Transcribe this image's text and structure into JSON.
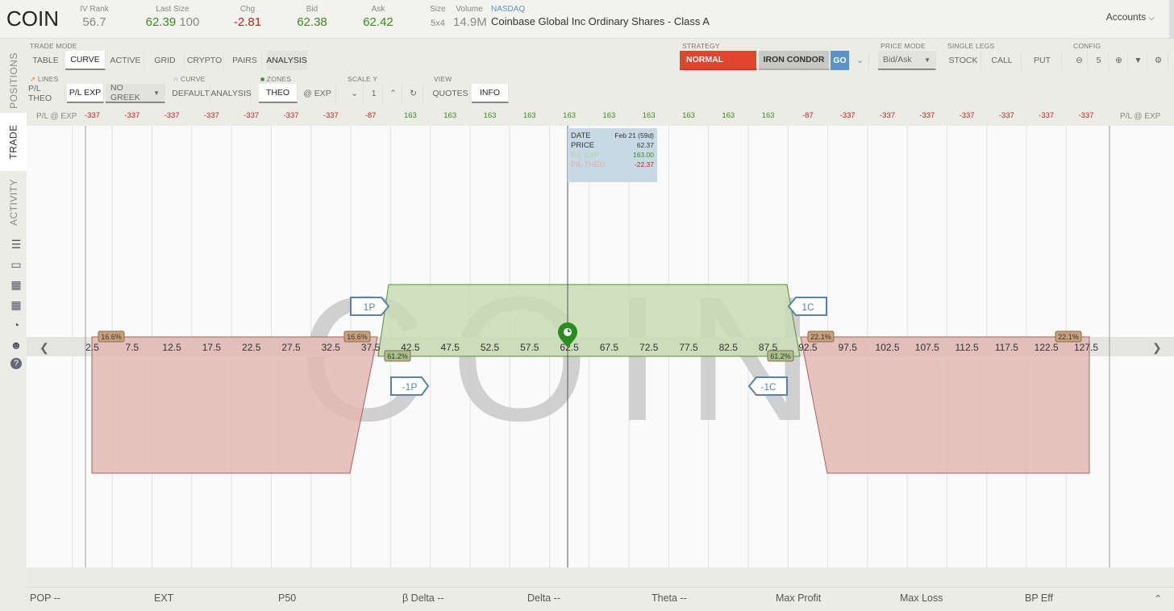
{
  "header": {
    "symbol": "COIN",
    "iv_rank": {
      "label": "IV Rank",
      "value": "56.7"
    },
    "last_size": {
      "label": "Last Size",
      "value": "62.39",
      "size": "100"
    },
    "chg": {
      "label": "Chg",
      "value": "-2.81"
    },
    "bid": {
      "label": "Bid",
      "value": "62.38"
    },
    "ask": {
      "label": "Ask",
      "value": "62.42"
    },
    "size": {
      "label": "Size",
      "value": "5x4"
    },
    "volume": {
      "label": "Volume",
      "value": "14.9M"
    },
    "exchange": "NASDAQ",
    "company": "Coinbase Global Inc Ordinary Shares - Class A",
    "accounts": "Accounts"
  },
  "sidebar": {
    "tabs": [
      "POSITIONS",
      "TRADE",
      "ACTIVITY"
    ]
  },
  "toolbar": {
    "trade_mode": {
      "label": "TRADE MODE",
      "buttons": [
        "TABLE",
        "CURVE",
        "ACTIVE",
        "GRID",
        "CRYPTO",
        "PAIRS",
        "ANALYSIS"
      ]
    },
    "lines": {
      "label": "LINES",
      "buttons": [
        "P/L THEO",
        "P/L EXP"
      ],
      "greek": "NO GREEK"
    },
    "curve": {
      "label": "CURVE",
      "buttons": [
        "DEFAULT",
        "ANALYSIS"
      ]
    },
    "zones": {
      "label": "ZONES",
      "buttons": [
        "THEO",
        "@ EXP"
      ]
    },
    "scale_y": {
      "label": "SCALE Y",
      "value": "1"
    },
    "view": {
      "label": "VIEW",
      "buttons": [
        "QUOTES",
        "INFO"
      ]
    },
    "strategy": {
      "label": "STRATEGY",
      "normal": "NORMAL",
      "iron_condor": "IRON CONDOR",
      "go": "GO"
    },
    "price_mode": {
      "label": "PRICE MODE",
      "value": "Bid/Ask"
    },
    "single_legs": {
      "label": "SINGLE LEGS",
      "buttons": [
        "STOCK",
        "CALL",
        "PUT"
      ]
    },
    "config": {
      "label": "CONFIG",
      "value": "5"
    }
  },
  "pl_row": {
    "label": "P/L @ EXP",
    "values": [
      "-337",
      "-337",
      "-337",
      "-337",
      "-337",
      "-337",
      "-337",
      "-87",
      "163",
      "163",
      "163",
      "163",
      "163",
      "163",
      "163",
      "163",
      "163",
      "163",
      "-87",
      "-337",
      "-337",
      "-337",
      "-337",
      "-337",
      "-337",
      "-337"
    ]
  },
  "chart": {
    "watermark": "COIN",
    "x_ticks": [
      "2.5",
      "7.5",
      "12.5",
      "17.5",
      "22.5",
      "27.5",
      "32.5",
      "37.5",
      "42.5",
      "47.5",
      "52.5",
      "57.5",
      "62.5",
      "67.5",
      "72.5",
      "77.5",
      "82.5",
      "87.5",
      "92.5",
      "97.5",
      "102.5",
      "107.5",
      "112.5",
      "117.5",
      "122.5",
      "127.5"
    ],
    "prob_labels": [
      "16.6%",
      "16.6%",
      "61.2%",
      "61.2%",
      "22.1%",
      "22.1%"
    ],
    "legs": {
      "p_long": "1P",
      "p_short": "-1P",
      "c_long": "1C",
      "c_short": "-1C"
    },
    "info": {
      "date_label": "DATE",
      "date": "Feb 21 (59d)",
      "price_label": "PRICE",
      "price": "62.37",
      "pl_exp_label": "P/L EXP",
      "pl_exp": "163.00",
      "pl_theo_label": "P/L THEO",
      "pl_theo": "-22.37"
    },
    "colors": {
      "profit": "#c8dcb4",
      "loss": "#e3b9b4",
      "green": "#3c8c18",
      "red": "#c8201c"
    }
  },
  "footer": {
    "items": [
      "POP --",
      "EXT",
      "P50",
      "β Delta --",
      "Delta --",
      "Theta --",
      "Max Profit",
      "Max Loss",
      "BP Eff"
    ]
  }
}
